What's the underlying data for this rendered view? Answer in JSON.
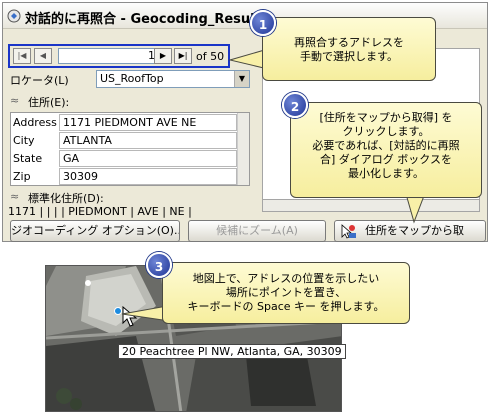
{
  "dialog": {
    "title": "対話的に再照合 - Geocoding_Resul",
    "nav": {
      "first": "|◀",
      "prev": "◀",
      "current": "1",
      "next": "▶",
      "last": "▶|",
      "of_label": "of 50"
    },
    "locator": {
      "label": "ロケータ(L)",
      "value": "US_RoofTop"
    },
    "address_section": "住所(E):",
    "fields": [
      {
        "label": "Address",
        "value": "1171 PIEDMONT AVE NE"
      },
      {
        "label": "City",
        "value": "ATLANTA"
      },
      {
        "label": "State",
        "value": "GA"
      },
      {
        "label": "Zip",
        "value": "30309"
      }
    ],
    "standardized_section": "標準化住所(D):",
    "standardized_value": "1171 |  |  |  | PIEDMONT | AVE | NE |",
    "buttons": {
      "geocoding_options": "ジオコーディング オプション(O)...",
      "zoom_candidates": "候補にズーム(A)",
      "pick_address": "住所をマップから取"
    }
  },
  "callouts": [
    {
      "number": "1",
      "lines": [
        "再照合するアドレスを",
        "手動で選択します。"
      ]
    },
    {
      "number": "2",
      "lines": [
        "[住所をマップから取得] を",
        "クリックします。",
        "必要であれば、[対話的に再照",
        "合] ダイアログ ボックスを",
        "最小化します。"
      ]
    },
    {
      "number": "3",
      "lines": [
        "地図上で、アドレスの位置を示したい",
        "場所にポイントを置き、",
        "キーボードの Space キー を押します。"
      ]
    }
  ],
  "map": {
    "address_label": "20 Peachtree Pl NW, Atlanta, GA, 30309"
  },
  "colors": {
    "highlight_border": "#1a35c8",
    "callout_bg": "#f8f0a8",
    "circle": "#2a43a8"
  }
}
